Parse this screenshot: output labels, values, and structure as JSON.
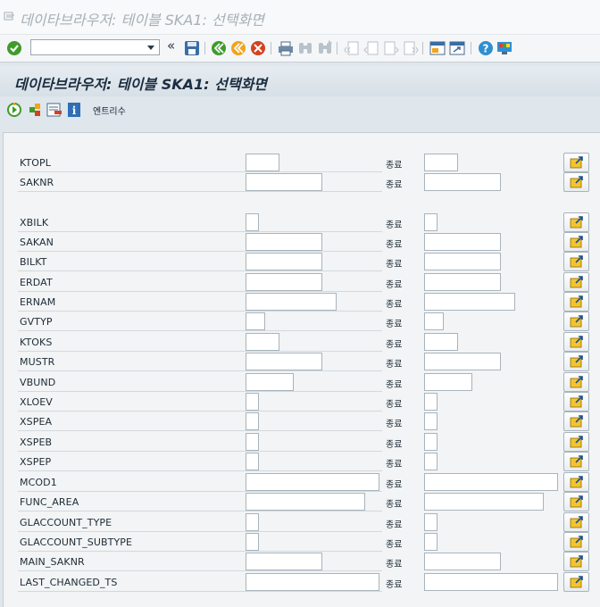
{
  "window": {
    "title": "데이타브라우저: 테이블 SKA1: 선택화면"
  },
  "toolbar": {
    "command_field_value": "",
    "icons": [
      "check-icon",
      "command-field",
      "collapse-icon",
      "save-icon",
      "back-icon",
      "exit-icon",
      "cancel-icon",
      "print-icon",
      "find-icon",
      "find-next-icon",
      "first-page-icon",
      "previous-page-icon",
      "next-page-icon",
      "last-page-icon",
      "create-session-icon",
      "shortcut-icon",
      "help-icon",
      "customize-layout-icon"
    ]
  },
  "screen": {
    "title": "데이타브라우저: 테이블 SKA1: 선택화면"
  },
  "app_toolbar": {
    "icons": [
      "execute-icon",
      "selection-options-icon",
      "delete-selection-icon",
      "info-icon"
    ],
    "entry_count_label": "엔트리수"
  },
  "to_label": "종료",
  "fields": [
    {
      "name": "KTOPL",
      "from": "",
      "to": ""
    },
    {
      "name": "SAKNR",
      "from": "",
      "to": ""
    },
    {
      "name": "XBILK",
      "from": "",
      "to": ""
    },
    {
      "name": "SAKAN",
      "from": "",
      "to": ""
    },
    {
      "name": "BILKT",
      "from": "",
      "to": ""
    },
    {
      "name": "ERDAT",
      "from": "",
      "to": ""
    },
    {
      "name": "ERNAM",
      "from": "",
      "to": ""
    },
    {
      "name": "GVTYP",
      "from": "",
      "to": ""
    },
    {
      "name": "KTOKS",
      "from": "",
      "to": ""
    },
    {
      "name": "MUSTR",
      "from": "",
      "to": ""
    },
    {
      "name": "VBUND",
      "from": "",
      "to": ""
    },
    {
      "name": "XLOEV",
      "from": "",
      "to": ""
    },
    {
      "name": "XSPEA",
      "from": "",
      "to": ""
    },
    {
      "name": "XSPEB",
      "from": "",
      "to": ""
    },
    {
      "name": "XSPEP",
      "from": "",
      "to": ""
    },
    {
      "name": "MCOD1",
      "from": "",
      "to": ""
    },
    {
      "name": "FUNC_AREA",
      "from": "",
      "to": ""
    },
    {
      "name": "GLACCOUNT_TYPE",
      "from": "",
      "to": ""
    },
    {
      "name": "GLACCOUNT_SUBTYPE",
      "from": "",
      "to": ""
    },
    {
      "name": "MAIN_SAKNR",
      "from": "",
      "to": ""
    },
    {
      "name": "LAST_CHANGED_TS",
      "from": "",
      "to": ""
    }
  ]
}
